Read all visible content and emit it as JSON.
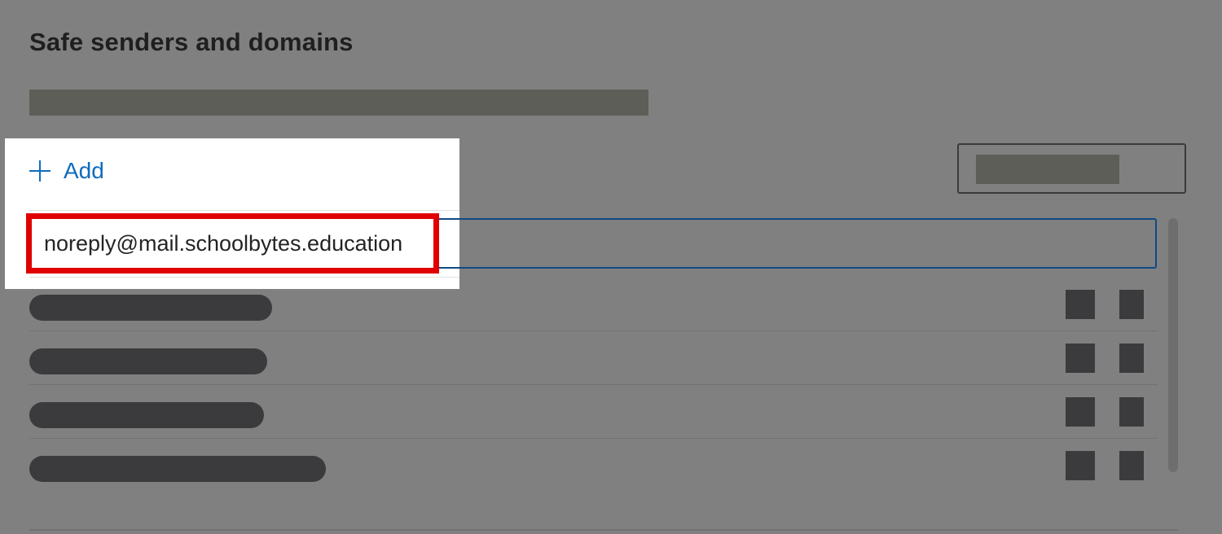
{
  "header": {
    "title": "Safe senders and domains"
  },
  "toolbar": {
    "add_label": "Add"
  },
  "editor": {
    "value": "noreply@mail.schoolbytes.education"
  },
  "icons": {
    "add": "plus-icon",
    "row_actions": [
      "edit-icon",
      "delete-icon"
    ]
  },
  "colors": {
    "accent": "#0f6cbd",
    "highlight_border": "#e00000",
    "focus_border": "#0f4a86",
    "overlay": "#808080",
    "redacted": "#3b3b3d"
  }
}
